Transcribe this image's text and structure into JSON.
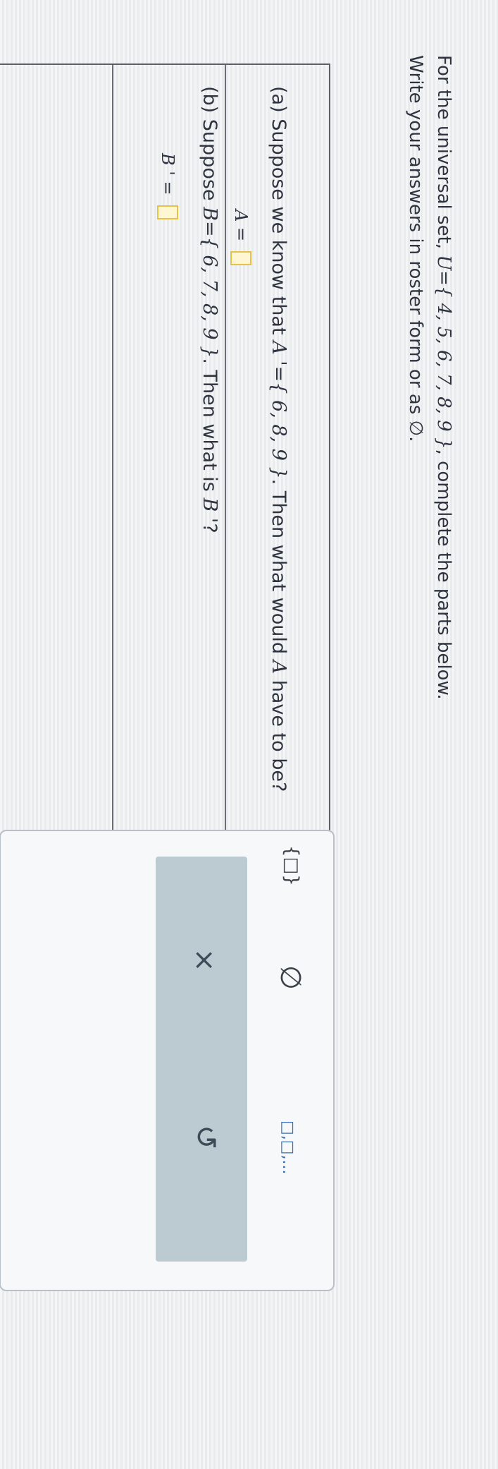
{
  "intro": {
    "line1_prefix": "For the universal set,",
    "line1_set": "U={ 4, 5, 6, 7, 8, 9 }",
    "line1_suffix": ", complete the parts below.",
    "line2": "Write your answers in roster form or as ∅."
  },
  "parts": {
    "a": {
      "question_prefix": "(a) Suppose we know that",
      "question_set": "A '={ 6, 8, 9 }",
      "question_middle": ". Then what would",
      "question_var": "A",
      "question_suffix": "have to be?",
      "answer_label": "A =",
      "answer_value": ""
    },
    "b": {
      "question_prefix": "(b) Suppose",
      "question_set": "B={ 6, 7, 8, 9 }",
      "question_middle": ". Then what is",
      "question_var": "B '",
      "question_suffix": "?",
      "answer_label": "B ' =",
      "answer_value": ""
    }
  },
  "toolbox": {
    "set_braces_icon": "{□}",
    "empty_set_icon": "∅",
    "list_icon": "□,□,...",
    "clear_icon": "×",
    "undo_icon": "↺"
  },
  "colors": {
    "answer_box_border": "#e7c24a",
    "action_bar": "#bccbd2",
    "list_icon": "#3a6fb0"
  }
}
